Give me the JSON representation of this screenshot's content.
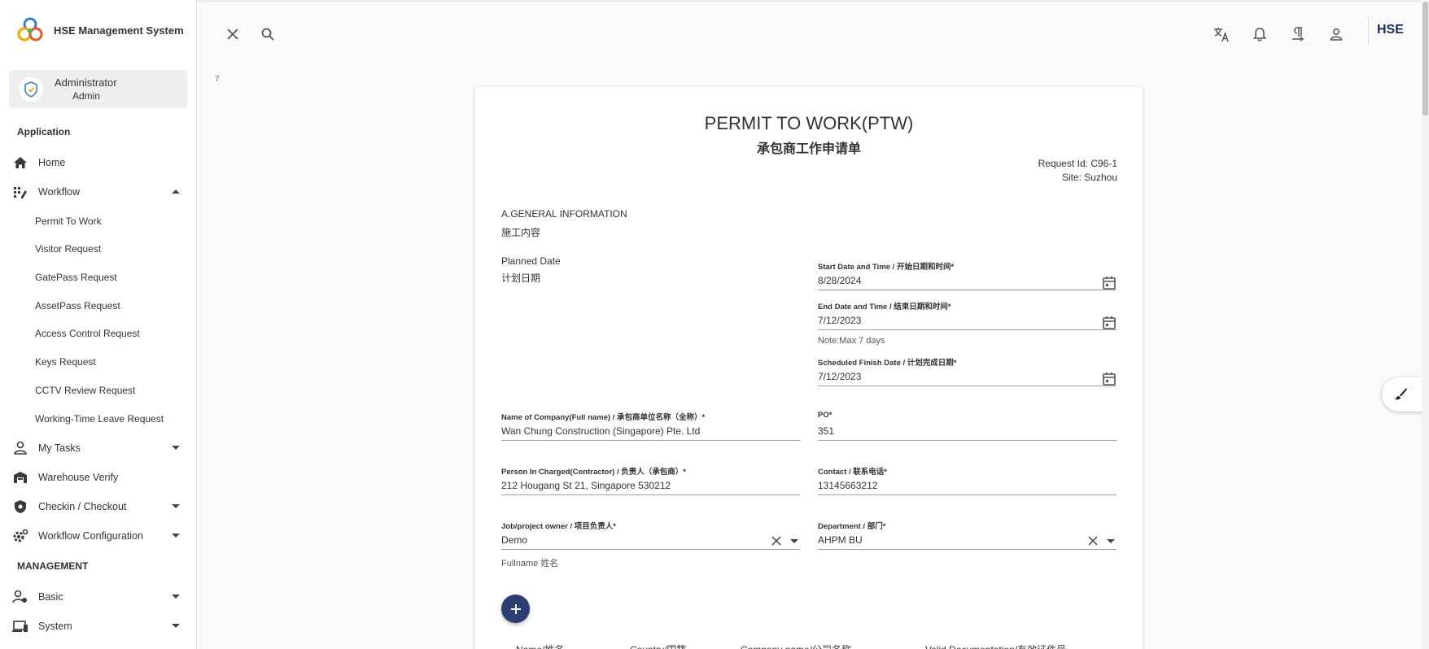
{
  "app": {
    "title": "HSE Management System",
    "brand_short": "HSE"
  },
  "user": {
    "name": "Administrator",
    "role": "Admin"
  },
  "sidebar": {
    "section_application": "Application",
    "section_management": "MANAGEMENT",
    "items": {
      "home": "Home",
      "workflow": "Workflow",
      "my_tasks": "My Tasks",
      "warehouse_verify": "Warehouse Verify",
      "checkin_checkout": "Checkin / Checkout",
      "workflow_configuration": "Workflow Configuration",
      "basic": "Basic",
      "system": "System"
    },
    "workflow_children": [
      "Permit To Work",
      "Visitor Request",
      "GatePass Request",
      "AssetPass Request",
      "Access Control Request",
      "Keys Request",
      "CCTV Review Request",
      "Working-Time Leave Request"
    ]
  },
  "topbar": {
    "icons": [
      "close-icon",
      "search-icon",
      "translate-icon",
      "bell-icon",
      "paragraph-icon",
      "person-icon"
    ]
  },
  "stray_text": "7",
  "form": {
    "title": "PERMIT TO WORK(PTW)",
    "subtitle": "承包商工作申请单",
    "request_id": "Request Id: C96-1",
    "site": "Site: Suzhou",
    "general_info": "A.GENERAL INFORMATION",
    "general_info_cn": "施工内容",
    "planned_date": "Planned Date",
    "planned_date_cn": "计划日期",
    "start_label": "Start Date and Time / 开始日期和时间*",
    "start_value": "8/28/2024",
    "end_label": "End Date and Time / 结束日期和时间*",
    "end_value": "7/12/2023",
    "end_note": "Note:Max 7 days",
    "finish_label": "Scheduled Finish Date / 计划完成日期*",
    "finish_value": "7/12/2023",
    "company_label": "Name of Company(Full name) / 承包商单位名称（全称）*",
    "company_value": "Wan Chung Construction (Singapore) Pte. Ltd",
    "po_label": "PO*",
    "po_value": "351",
    "person_label": "Person In Charged(Contractor) / 负责人（承包商）*",
    "person_value": "212 Hougang St 21, Singapore 530212",
    "contact_label": "Contact / 联系电话*",
    "contact_value": "13145663212",
    "owner_label": "Job/project owner / 项目负责人*",
    "owner_value": "Demo",
    "owner_hint": "Fullname 姓名",
    "dept_label": "Department / 部门*",
    "dept_value": "AHPM BU",
    "table_headers": [
      "Name/姓名",
      "Country/国籍",
      "Company name/公司名称",
      "Valid Documentation/有效证件号"
    ]
  },
  "colors": {
    "accent": "#2c3e72",
    "brand": "#1a2d56"
  }
}
